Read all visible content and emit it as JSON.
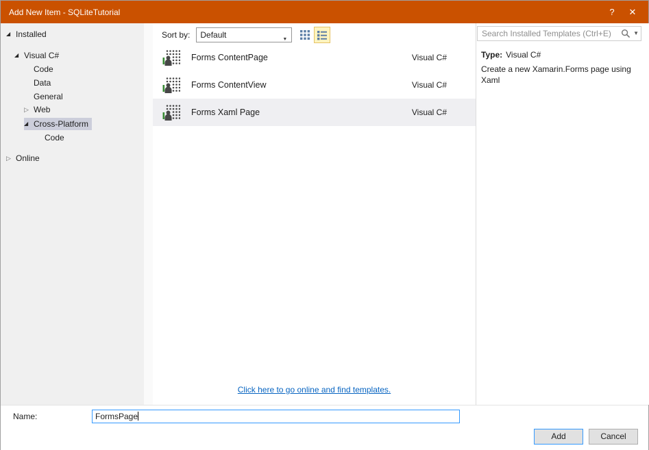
{
  "titlebar": {
    "title": "Add New Item - SQLiteTutorial",
    "help": "?",
    "close": "✕"
  },
  "icons": {
    "expanded": "◢",
    "collapsed": "▷",
    "combo_arrow": "▼",
    "search_dropdown": "▼"
  },
  "tree": {
    "items": [
      {
        "label": "Installed"
      },
      {
        "label": "Visual C#"
      },
      {
        "label": "Code"
      },
      {
        "label": "Data"
      },
      {
        "label": "General"
      },
      {
        "label": "Web"
      },
      {
        "label": "Cross-Platform"
      },
      {
        "label": "Code"
      },
      {
        "label": "Online"
      }
    ]
  },
  "toolbar": {
    "sort_label": "Sort by:",
    "sort_value": "Default"
  },
  "search": {
    "placeholder": "Search Installed Templates (Ctrl+E)"
  },
  "templates": {
    "items": [
      {
        "name": "Forms ContentPage",
        "language": "Visual C#"
      },
      {
        "name": "Forms ContentView",
        "language": "Visual C#"
      },
      {
        "name": "Forms Xaml Page",
        "language": "Visual C#"
      }
    ],
    "online_link": "Click here to go online and find templates."
  },
  "details": {
    "type_label": "Type:",
    "type_value": "Visual C#",
    "description": "Create a new Xamarin.Forms page using Xaml"
  },
  "footer": {
    "name_label": "Name:",
    "name_value": "FormsPage",
    "add_label": "Add",
    "cancel_label": "Cancel"
  },
  "colors": {
    "titlebar": "#CA5100",
    "focus_border": "#3399FF",
    "link": "#0563C1",
    "tree_selection": "#CCCEDB",
    "latched_button_bg": "#FDF4BF",
    "latched_button_border": "#E5C365",
    "panel_bg": "#F0F0F0",
    "selected_row_bg": "#EFEFF2"
  }
}
